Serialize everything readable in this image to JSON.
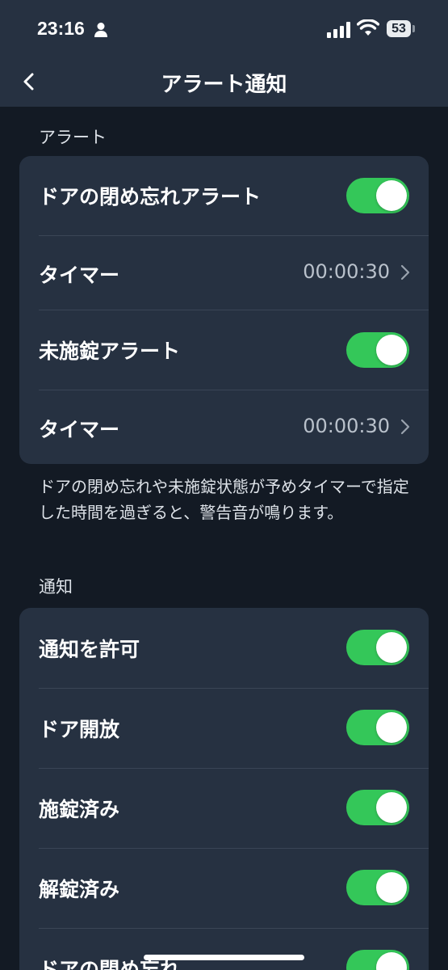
{
  "status_bar": {
    "time": "23:16",
    "battery": "53"
  },
  "nav": {
    "title": "アラート通知",
    "back_icon": "chevron-left-icon"
  },
  "alert_section": {
    "header": "アラート",
    "rows": [
      {
        "label": "ドアの閉め忘れアラート",
        "type": "toggle",
        "on": true
      },
      {
        "label": "タイマー",
        "type": "value",
        "value": "00:00:30"
      },
      {
        "label": "未施錠アラート",
        "type": "toggle",
        "on": true
      },
      {
        "label": "タイマー",
        "type": "value",
        "value": "00:00:30"
      }
    ],
    "footnote": "ドアの閉め忘れや未施錠状態が予めタイマーで指定した時間を過ぎると、警告音が鳴ります。"
  },
  "notify_section": {
    "header": "通知",
    "rows": [
      {
        "label": "通知を許可",
        "type": "toggle",
        "on": true
      },
      {
        "label": "ドア開放",
        "type": "toggle",
        "on": true
      },
      {
        "label": "施錠済み",
        "type": "toggle",
        "on": true
      },
      {
        "label": "解錠済み",
        "type": "toggle",
        "on": true
      },
      {
        "label": "ドアの閉め忘れ",
        "type": "toggle",
        "on": true
      }
    ]
  },
  "colors": {
    "toggle_on": "#34c759",
    "card_bg": "#263141",
    "page_bg": "#131a24"
  }
}
